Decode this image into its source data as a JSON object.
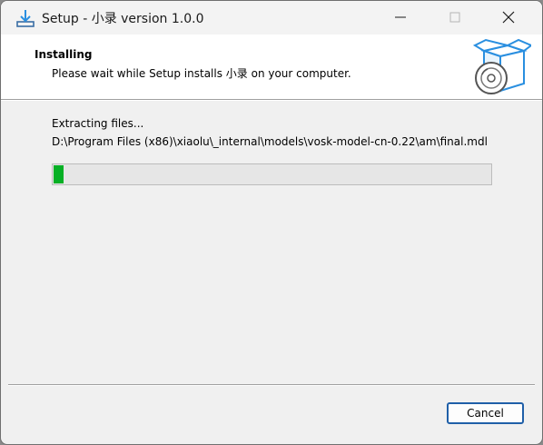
{
  "window": {
    "title": "Setup - 小录 version 1.0.0"
  },
  "header": {
    "title": "Installing",
    "subtitle": "Please wait while Setup installs 小录 on your computer."
  },
  "main": {
    "status": "Extracting files...",
    "current_file": "D:\\Program Files (x86)\\xiaolu\\_internal\\models\\vosk-model-cn-0.22\\am\\final.mdl",
    "progress_fraction": 0.022,
    "progress_color": "#06b025"
  },
  "footer": {
    "cancel_label": "Cancel"
  }
}
